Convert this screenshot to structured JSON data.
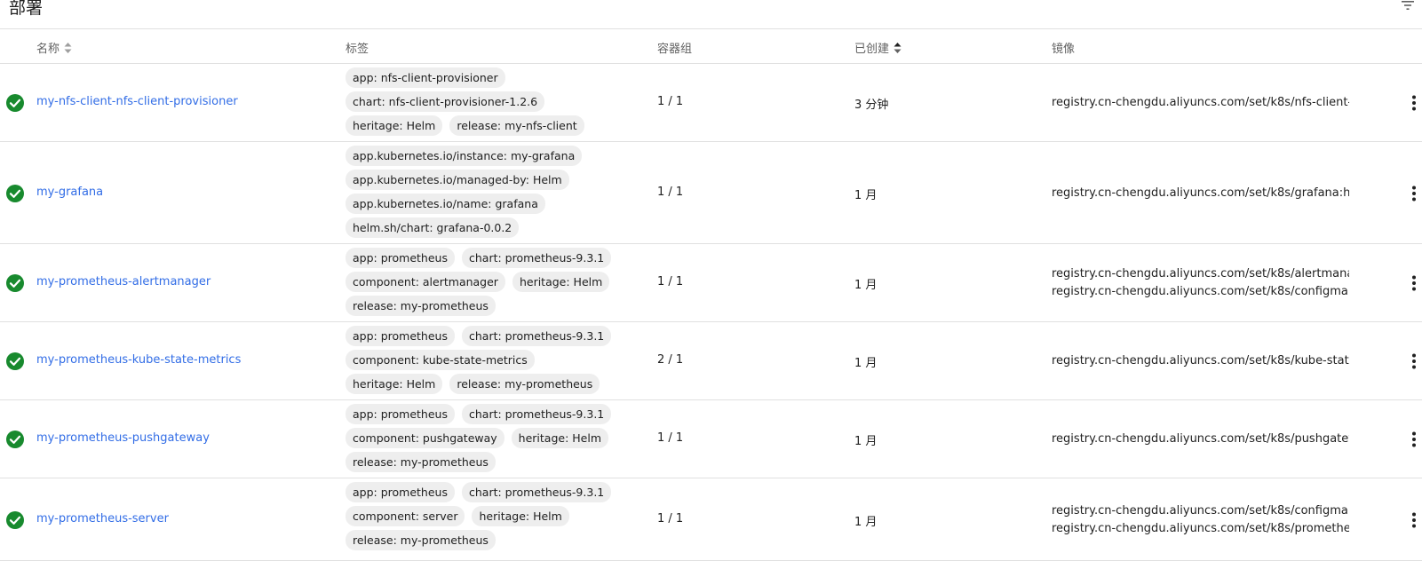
{
  "page": {
    "title": "部署"
  },
  "columns": {
    "name": "名称",
    "labels": "标签",
    "pods": "容器组",
    "created": "已创建",
    "images": "镜像"
  },
  "colors": {
    "link": "#326de6",
    "success": "#188a2e",
    "chip_bg": "#eeeeee",
    "divider": "#e0e0e0"
  },
  "rows": [
    {
      "name": "my-nfs-client-nfs-client-provisioner",
      "labels": [
        "app: nfs-client-provisioner",
        "chart: nfs-client-provisioner-1.2.6",
        "heritage: Helm",
        "release: my-nfs-client"
      ],
      "pods": "1 / 1",
      "created": "3 分钟",
      "images": [
        "registry.cn-chengdu.aliyuncs.com/set/k8s/nfs-client-"
      ]
    },
    {
      "name": "my-grafana",
      "labels": [
        "app.kubernetes.io/instance: my-grafana",
        "app.kubernetes.io/managed-by: Helm",
        "app.kubernetes.io/name: grafana",
        "helm.sh/chart: grafana-0.0.2"
      ],
      "pods": "1 / 1",
      "created": "1 月",
      "images": [
        "registry.cn-chengdu.aliyuncs.com/set/k8s/grafana:h"
      ]
    },
    {
      "name": "my-prometheus-alertmanager",
      "labels": [
        "app: prometheus",
        "chart: prometheus-9.3.1",
        "component: alertmanager",
        "heritage: Helm",
        "release: my-prometheus"
      ],
      "pods": "1 / 1",
      "created": "1 月",
      "images": [
        "registry.cn-chengdu.aliyuncs.com/set/k8s/alertmana",
        "registry.cn-chengdu.aliyuncs.com/set/k8s/configma"
      ]
    },
    {
      "name": "my-prometheus-kube-state-metrics",
      "labels": [
        "app: prometheus",
        "chart: prometheus-9.3.1",
        "component: kube-state-metrics",
        "heritage: Helm",
        "release: my-prometheus"
      ],
      "pods": "2 / 1",
      "created": "1 月",
      "images": [
        "registry.cn-chengdu.aliyuncs.com/set/k8s/kube-stat"
      ]
    },
    {
      "name": "my-prometheus-pushgateway",
      "labels": [
        "app: prometheus",
        "chart: prometheus-9.3.1",
        "component: pushgateway",
        "heritage: Helm",
        "release: my-prometheus"
      ],
      "pods": "1 / 1",
      "created": "1 月",
      "images": [
        "registry.cn-chengdu.aliyuncs.com/set/k8s/pushgatev"
      ]
    },
    {
      "name": "my-prometheus-server",
      "labels": [
        "app: prometheus",
        "chart: prometheus-9.3.1",
        "component: server",
        "heritage: Helm",
        "release: my-prometheus"
      ],
      "pods": "1 / 1",
      "created": "1 月",
      "images": [
        "registry.cn-chengdu.aliyuncs.com/set/k8s/configma",
        "registry.cn-chengdu.aliyuncs.com/set/k8s/promethe"
      ]
    }
  ]
}
